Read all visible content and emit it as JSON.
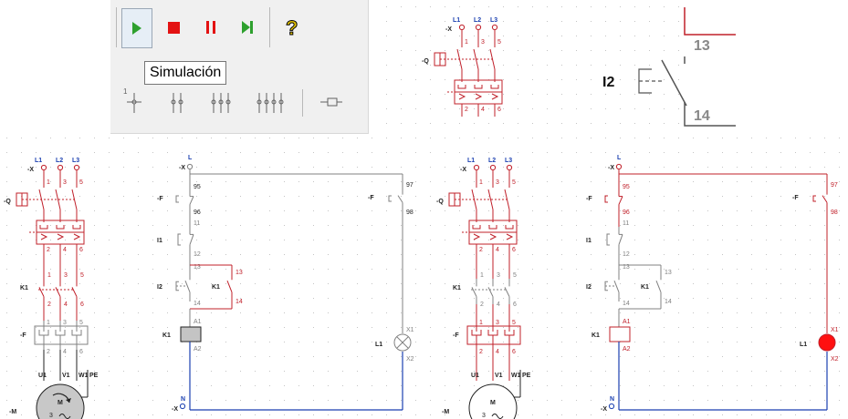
{
  "toolbar": {
    "buttons": [
      {
        "name": "play-button",
        "icon": "play-icon",
        "color": "#2ea02e"
      },
      {
        "name": "stop-button",
        "icon": "stop-icon",
        "color": "#e31212"
      },
      {
        "name": "pause-button",
        "icon": "pause-icon",
        "color": "#e31212"
      },
      {
        "name": "step-button",
        "icon": "step-forward-icon",
        "color": "#2ea02e"
      },
      {
        "name": "help-button",
        "icon": "question-mark-icon",
        "color": "#e0c000"
      }
    ],
    "tooltip": "Simulación",
    "contact_tools": [
      "single-contact-icon",
      "double-contact-icon",
      "triple-contact-icon",
      "quad-contact-icon",
      "plug-icon"
    ]
  },
  "colors": {
    "red": "#c0202a",
    "gray": "#808080",
    "blue": "#1a3fb0",
    "dark": "#222222",
    "grid": "#bdbdbd",
    "lamp_on": "#ff1010"
  },
  "labels": {
    "L1": "L1",
    "L2": "L2",
    "L3": "L3",
    "X": "-X",
    "Q": "-Q",
    "F": "-F",
    "K1": "K1",
    "M": "-M",
    "N": "N",
    "L": "L",
    "I1": "I1",
    "I2": "I2",
    "lamp": "L1",
    "t1": "1",
    "t2": "2",
    "t3": "3",
    "t4": "4",
    "t5": "5",
    "t6": "6",
    "U1": "U1",
    "V1": "V1",
    "W1": "W1",
    "PE": "PE",
    "motorM": "M",
    "motor3": "3",
    "c95": "95",
    "c96": "96",
    "c97": "97",
    "c98": "98",
    "c11": "11",
    "c12": "12",
    "c13": "13",
    "c14": "14",
    "A1": "A1",
    "A2": "A2",
    "X1": "X1",
    "X2": "X2"
  },
  "detail": {
    "label": "I2",
    "top": "13",
    "bottom": "14"
  }
}
